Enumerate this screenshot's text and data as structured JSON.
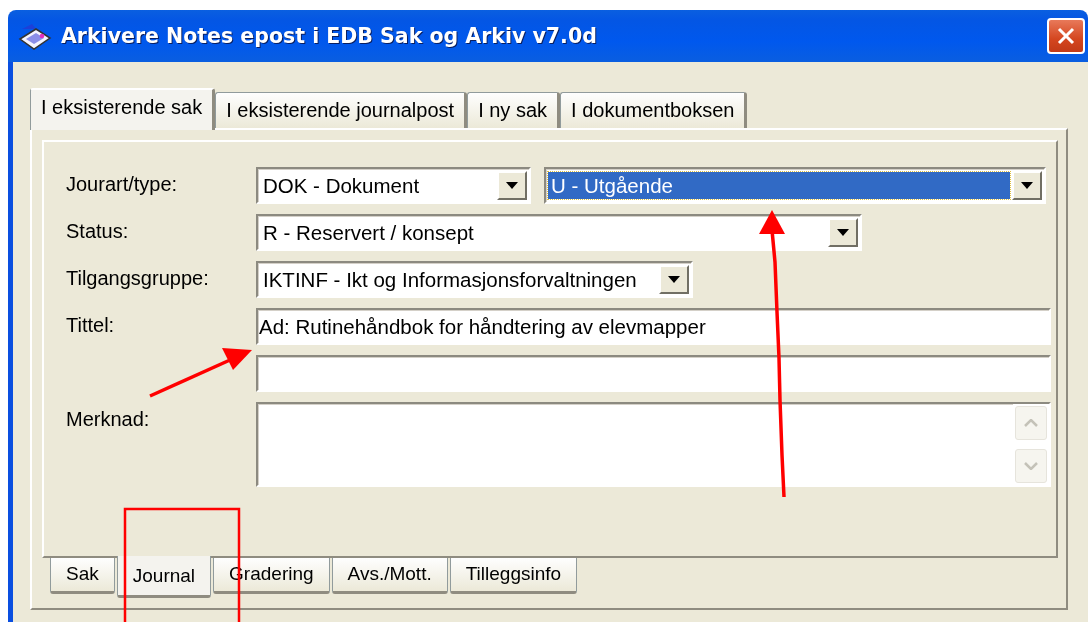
{
  "window": {
    "title": "Arkivere Notes epost i EDB Sak og Arkiv v7.0d"
  },
  "tabs": [
    {
      "label": "I eksisterende sak",
      "selected": true
    },
    {
      "label": "I eksisterende journalpost",
      "selected": false
    },
    {
      "label": "I ny sak",
      "selected": false
    },
    {
      "label": "I dokumentboksen",
      "selected": false
    }
  ],
  "rows": [
    {
      "label": "Jourart/type:",
      "controls": [
        {
          "kind": "combo",
          "value": "DOK - Dokument",
          "focused": false
        },
        {
          "kind": "combo",
          "value": "U - Utgående",
          "focused": true
        }
      ]
    },
    {
      "label": "Status:",
      "controls": [
        {
          "kind": "combo",
          "value": "R - Reservert / konsept",
          "focused": false
        }
      ]
    },
    {
      "label": "Tilgangsgruppe:",
      "controls": [
        {
          "kind": "combo",
          "value": "IKTINF - Ikt og Informasjonsforvaltningen",
          "focused": false
        }
      ]
    },
    {
      "label": "Tittel:",
      "controls": [
        {
          "kind": "text",
          "value": "Ad: Rutinehåndbok for håndtering av elevmapper"
        }
      ]
    },
    {
      "controls": [
        {
          "kind": "text"
        }
      ]
    },
    {
      "label": "Merknad:",
      "controls": [
        {
          "kind": "memo"
        }
      ]
    }
  ],
  "bottom_tabs": [
    {
      "label": "Sak",
      "selected": false
    },
    {
      "label": "Journal",
      "selected": true
    },
    {
      "label": "Gradering",
      "selected": false
    },
    {
      "label": "Avs./Mott.",
      "selected": false
    },
    {
      "label": "Tilleggsinfo",
      "selected": false
    }
  ]
}
